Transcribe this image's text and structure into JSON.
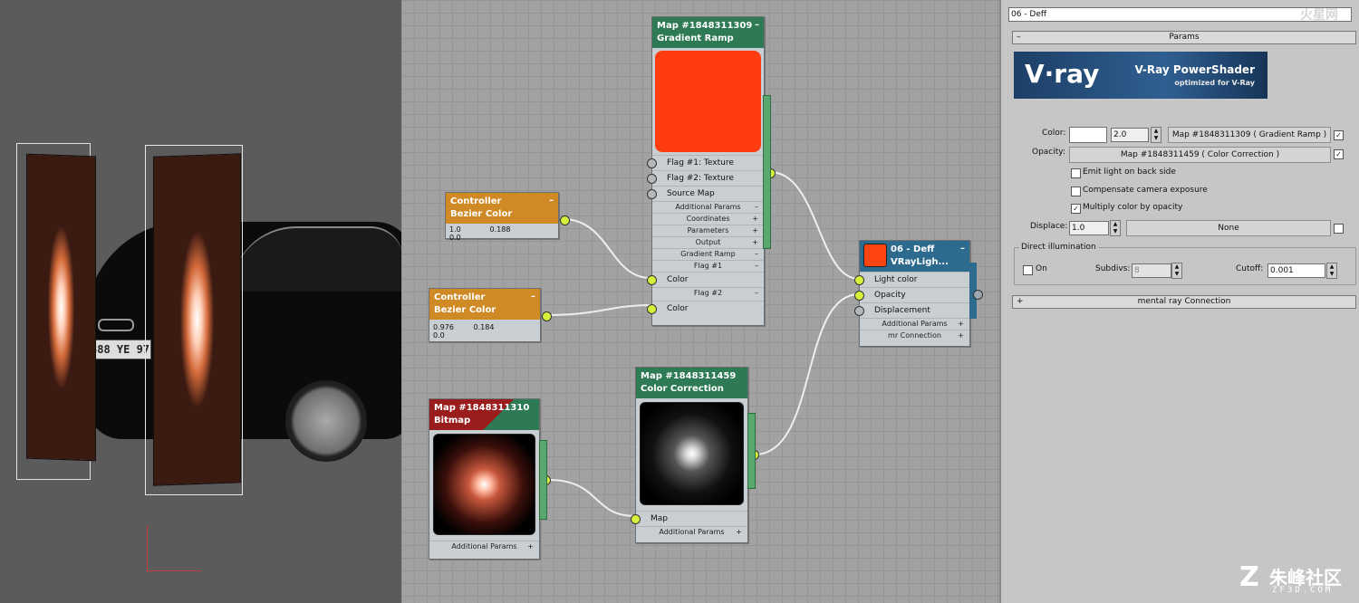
{
  "viewport": {
    "plate_text": "388 YE 97"
  },
  "nodes": {
    "gradient": {
      "title_line1": "Map #1848311309",
      "title_line2": "Gradient Ramp",
      "rows": [
        "Flag #1: Texture",
        "Flag #2: Texture",
        "Source Map"
      ],
      "subs": [
        "Additional Params",
        "Coordinates",
        "Parameters",
        "Output",
        "Gradient Ramp",
        "Flag #1"
      ],
      "color1": "Color",
      "flag2": "Flag #2",
      "color2": "Color"
    },
    "bezier1": {
      "title_line1": "Controller",
      "title_line2": "Bezier Color",
      "v1": "1.0",
      "v2": "0.188",
      "v3": "0.0"
    },
    "bezier2": {
      "title_line1": "Controller",
      "title_line2": "Bezier Color",
      "v1": "0.976",
      "v2": "0.184",
      "v3": "0.0"
    },
    "bitmap": {
      "title_line1": "Map #1848311310",
      "title_line2": "Bitmap",
      "sub": "Additional Params"
    },
    "colorcorr": {
      "title_line1": "Map #1848311459",
      "title_line2": "Color Correction",
      "row": "Map",
      "sub": "Additional Params"
    },
    "vray": {
      "title_line1": "06 - Deff",
      "title_line2": "VRayLigh...",
      "rows": [
        "Light color",
        "Opacity",
        "Displacement"
      ],
      "subs": [
        "Additional Params",
        "mr Connection"
      ]
    }
  },
  "panel": {
    "material_name": "06 - Deff",
    "params_rollout": "Params",
    "vray_logo": "V·ray",
    "vray_title": "V-Ray PowerShader",
    "vray_sub": "optimized for V-Ray",
    "color_label": "Color:",
    "color_mult": "2.0",
    "color_map": "Map #1848311309  ( Gradient Ramp )",
    "opacity_label": "Opacity:",
    "opacity_map": "Map #1848311459  ( Color Correction )",
    "emit_back": "Emit light on back side",
    "compensate": "Compensate camera exposure",
    "multiply": "Multiply color by opacity",
    "displace_label": "Displace:",
    "displace_val": "1.0",
    "displace_map": "None",
    "direct_label": "Direct illumination",
    "on_label": "On",
    "subdivs_label": "Subdivs:",
    "subdivs_val": "8",
    "cutoff_label": "Cutoff:",
    "cutoff_val": "0.001",
    "mental_rollout": "mental ray Connection"
  },
  "watermark": {
    "text": "朱峰社区",
    "sub": "ZF3D.COM",
    "top_logo": "火星网"
  },
  "colors": {
    "gradient_swatch": "#ff3b10",
    "green_header": "#2d7a55",
    "orange_header": "#cf8a25",
    "socket_yellow": "#d7f13a"
  }
}
